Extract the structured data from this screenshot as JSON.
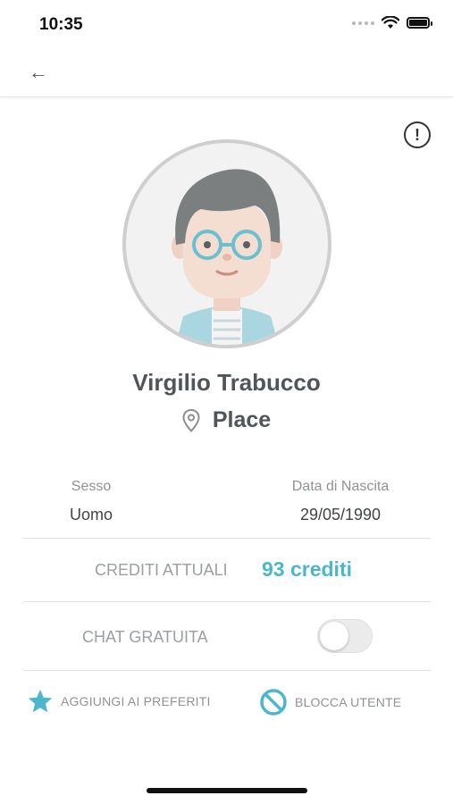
{
  "status_bar": {
    "time": "10:35"
  },
  "nav": {
    "back_icon": "arrow-left-icon",
    "report_icon": "exclamation-circle-icon",
    "report_symbol": "!"
  },
  "profile": {
    "name": "Virgilio Trabucco",
    "location": "Place",
    "avatar_icon": "cartoon-man-with-glasses"
  },
  "info": {
    "sex_label": "Sesso",
    "sex_value": "Uomo",
    "birth_label": "Data di Nascita",
    "birth_value": "29/05/1990"
  },
  "credits": {
    "label": "CREDITI ATTUALI",
    "value": "93 crediti"
  },
  "chat": {
    "label": "CHAT GRATUITA",
    "enabled": false
  },
  "actions": {
    "favorite_label": "AGGIUNGI AI PREFERITI",
    "favorite_icon": "star-icon",
    "block_label": "BLOCCA UTENTE",
    "block_icon": "block-icon"
  },
  "colors": {
    "accent": "#4cb7cc",
    "text": "#4f5558",
    "muted": "#9a9fa1"
  }
}
